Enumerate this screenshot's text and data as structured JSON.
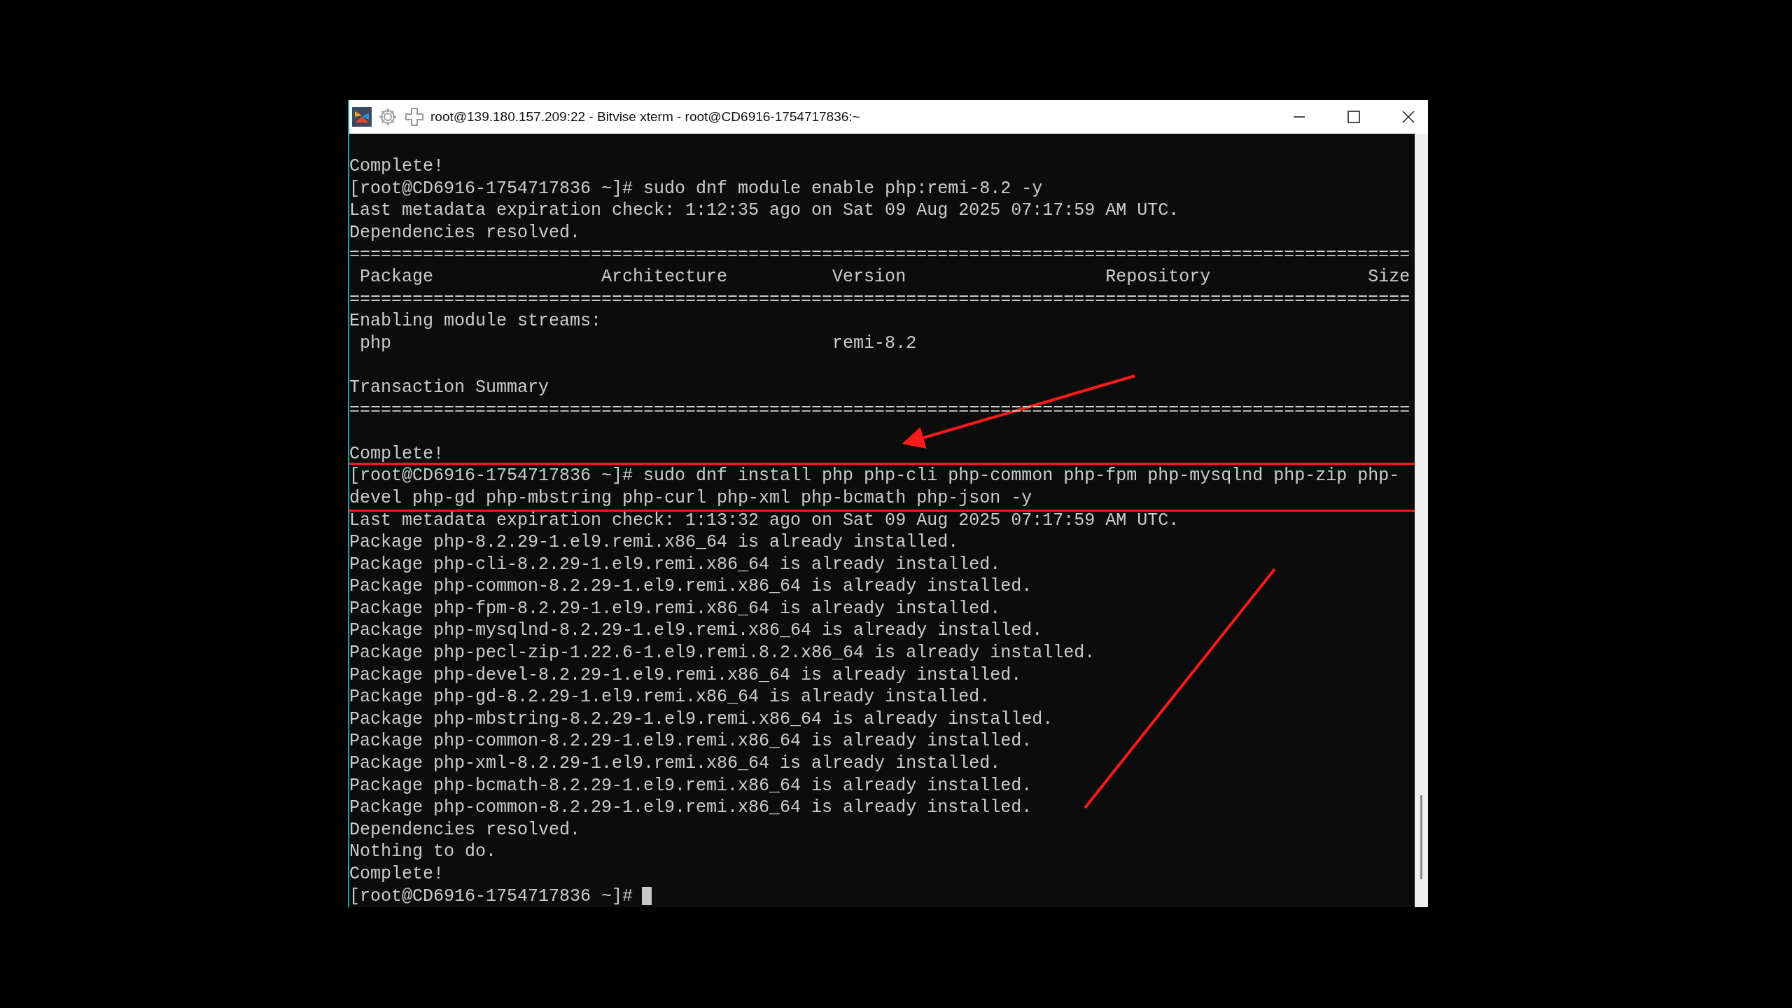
{
  "window": {
    "title": "root@139.180.157.209:22 - Bitvise xterm - root@CD6916-1754717836:~"
  },
  "terminal": {
    "cursor_visible": true,
    "blocks": [
      {
        "highlighted": false,
        "lines": [
          {
            "kind": "text",
            "text": "Complete!"
          },
          {
            "kind": "text",
            "text": "[root@CD6916-1754717836 ~]# sudo dnf module enable php:remi-8.2 -y"
          },
          {
            "kind": "text",
            "text": "Last metadata expiration check: 1:12:35 ago on Sat 09 Aug 2025 07:17:59 AM UTC."
          },
          {
            "kind": "text",
            "text": "Dependencies resolved."
          },
          {
            "kind": "text",
            "text": "====================================================================================================="
          },
          {
            "kind": "text",
            "text": " Package                Architecture          Version                   Repository               Size"
          },
          {
            "kind": "text",
            "text": "====================================================================================================="
          },
          {
            "kind": "text",
            "text": "Enabling module streams:"
          },
          {
            "kind": "text",
            "text": " php                                          remi-8.2"
          },
          {
            "kind": "blank"
          },
          {
            "kind": "text",
            "text": "Transaction Summary"
          },
          {
            "kind": "text",
            "text": "====================================================================================================="
          },
          {
            "kind": "blank"
          },
          {
            "kind": "text",
            "text": "Complete!"
          }
        ]
      },
      {
        "highlighted": true,
        "lines": [
          {
            "kind": "text",
            "text": "[root@CD6916-1754717836 ~]# sudo dnf install php php-cli php-common php-fpm php-mysqlnd php-zip php-"
          },
          {
            "kind": "text",
            "text": "devel php-gd php-mbstring php-curl php-xml php-bcmath php-json -y"
          }
        ]
      },
      {
        "highlighted": false,
        "lines": [
          {
            "kind": "text",
            "text": "Last metadata expiration check: 1:13:32 ago on Sat 09 Aug 2025 07:17:59 AM UTC."
          },
          {
            "kind": "text",
            "text": "Package php-8.2.29-1.el9.remi.x86_64 is already installed."
          },
          {
            "kind": "text",
            "text": "Package php-cli-8.2.29-1.el9.remi.x86_64 is already installed."
          },
          {
            "kind": "text",
            "text": "Package php-common-8.2.29-1.el9.remi.x86_64 is already installed."
          },
          {
            "kind": "text",
            "text": "Package php-fpm-8.2.29-1.el9.remi.x86_64 is already installed."
          },
          {
            "kind": "text",
            "text": "Package php-mysqlnd-8.2.29-1.el9.remi.x86_64 is already installed."
          },
          {
            "kind": "text",
            "text": "Package php-pecl-zip-1.22.6-1.el9.remi.8.2.x86_64 is already installed."
          },
          {
            "kind": "text",
            "text": "Package php-devel-8.2.29-1.el9.remi.x86_64 is already installed."
          },
          {
            "kind": "text",
            "text": "Package php-gd-8.2.29-1.el9.remi.x86_64 is already installed."
          },
          {
            "kind": "text",
            "text": "Package php-mbstring-8.2.29-1.el9.remi.x86_64 is already installed."
          },
          {
            "kind": "text",
            "text": "Package php-common-8.2.29-1.el9.remi.x86_64 is already installed."
          },
          {
            "kind": "text",
            "text": "Package php-xml-8.2.29-1.el9.remi.x86_64 is already installed."
          },
          {
            "kind": "text",
            "text": "Package php-bcmath-8.2.29-1.el9.remi.x86_64 is already installed."
          },
          {
            "kind": "text",
            "text": "Package php-common-8.2.29-1.el9.remi.x86_64 is already installed."
          },
          {
            "kind": "text",
            "text": "Dependencies resolved."
          },
          {
            "kind": "text",
            "text": "Nothing to do."
          },
          {
            "kind": "text",
            "text": "Complete!"
          },
          {
            "kind": "prompt",
            "text": "[root@CD6916-1754717836 ~]#"
          }
        ]
      }
    ]
  }
}
